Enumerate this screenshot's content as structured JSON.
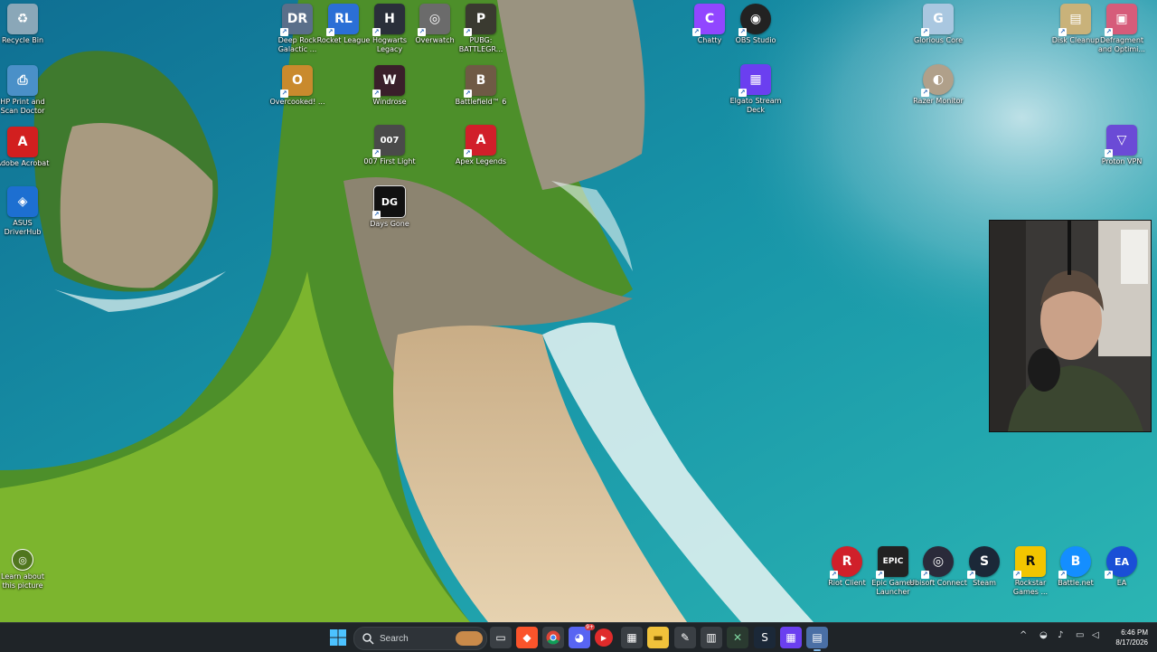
{
  "desktop_icons_left": [
    {
      "label": "Recycle Bin",
      "icon": "recycle-bin-icon",
      "color": "#8aa7b8",
      "glyph": "♻"
    },
    {
      "label": "HP Print and Scan Doctor",
      "icon": "printer-icon",
      "color": "#4a90c8",
      "glyph": "⎙"
    },
    {
      "label": "Adobe Acrobat",
      "icon": "acrobat-icon",
      "color": "#d21f1f",
      "glyph": "A"
    },
    {
      "label": "ASUS DriverHub",
      "icon": "asus-icon",
      "color": "#1d6fd1",
      "glyph": "◈"
    }
  ],
  "desktop_icons_games": [
    {
      "label": "Deep Rock Galactic ...",
      "icon": "deep-rock-icon",
      "color": "#5a6f8a",
      "glyph": "DR"
    },
    {
      "label": "Rocket League",
      "icon": "rocket-league-icon",
      "color": "#2b6fd6",
      "glyph": "RL"
    },
    {
      "label": "Hogwarts Legacy",
      "icon": "hogwarts-icon",
      "color": "#2a2f3a",
      "glyph": "H"
    },
    {
      "label": "Overwatch",
      "icon": "overwatch-icon",
      "color": "#6b6b6b",
      "glyph": "◎"
    },
    {
      "label": "PUBG: BATTLEGR...",
      "icon": "pubg-icon",
      "color": "#3a3a30",
      "glyph": "P"
    },
    {
      "label": "Overcooked! ...",
      "icon": "overcooked-icon",
      "color": "#c98a2d",
      "glyph": "O"
    },
    {
      "label": "Windrose",
      "icon": "windrose-icon",
      "color": "#3a1f2a",
      "glyph": "W"
    },
    {
      "label": "Battlefield™ 6",
      "icon": "battlefield-icon",
      "color": "#6f5a45",
      "glyph": "B"
    },
    {
      "label": "007 First Light",
      "icon": "007-icon",
      "color": "#4a4a4a",
      "glyph": "007"
    },
    {
      "label": "Apex Legends",
      "icon": "apex-icon",
      "color": "#d11f2a",
      "glyph": "A"
    },
    {
      "label": "Days Gone",
      "icon": "days-gone-icon",
      "color": "#111111",
      "glyph": "DG"
    }
  ],
  "desktop_icons_apps": [
    {
      "label": "Chatty",
      "icon": "chatty-icon",
      "color": "#9146ff",
      "glyph": "C"
    },
    {
      "label": "OBS Studio",
      "icon": "obs-icon",
      "color": "#222222",
      "glyph": "◉"
    },
    {
      "label": "Glorious Core",
      "icon": "glorious-icon",
      "color": "#a9c7e0",
      "glyph": "G"
    },
    {
      "label": "Elgato Stream Deck",
      "icon": "stream-deck-icon",
      "color": "#6b3ff0",
      "glyph": "▦"
    },
    {
      "label": "Razer Monitor",
      "icon": "monitor-icon",
      "color": "#b0a08a",
      "glyph": "◐"
    },
    {
      "label": "Disk Cleanup",
      "icon": "disk-cleanup-icon",
      "color": "#c9b27a",
      "glyph": "▤"
    },
    {
      "label": "Defragment and Optimi...",
      "icon": "defrag-icon",
      "color": "#d65c7a",
      "glyph": "▣"
    },
    {
      "label": "Proton VPN",
      "icon": "proton-vpn-icon",
      "color": "#6b4bd6",
      "glyph": "▽"
    }
  ],
  "launcher_icons": [
    {
      "label": "Riot Client",
      "icon": "riot-icon",
      "color": "#d0202a",
      "glyph": "R"
    },
    {
      "label": "Epic Games Launcher",
      "icon": "epic-icon",
      "color": "#222222",
      "glyph": "EPIC"
    },
    {
      "label": "Ubisoft Connect",
      "icon": "ubisoft-icon",
      "color": "#2a2a3a",
      "glyph": "◎"
    },
    {
      "label": "Steam",
      "icon": "steam-icon",
      "color": "#1b2838",
      "glyph": "S"
    },
    {
      "label": "Rockstar Games ...",
      "icon": "rockstar-icon",
      "color": "#f2c500",
      "glyph": "R"
    },
    {
      "label": "Battle.net",
      "icon": "battlenet-icon",
      "color": "#148eff",
      "glyph": "B"
    },
    {
      "label": "EA",
      "icon": "ea-icon",
      "color": "#1a4fd6",
      "glyph": "EA"
    }
  ],
  "learn_picture": {
    "label": "Learn about this picture",
    "icon": "camera-icon"
  },
  "taskbar": {
    "search_placeholder": "Search",
    "apps": [
      {
        "name": "task-view-icon",
        "color": "#3a3f44",
        "glyph": "▭"
      },
      {
        "name": "brave-icon",
        "color": "#fb542b",
        "glyph": "◆"
      },
      {
        "name": "chrome-icon",
        "color": "#3a3f44",
        "glyph": "◍"
      },
      {
        "name": "discord-icon",
        "color": "#5865f2",
        "glyph": "◕"
      },
      {
        "name": "youtube-icon",
        "color": "#e02b2b",
        "glyph": "▶"
      },
      {
        "name": "store-icon",
        "color": "#3a3f44",
        "glyph": "▦"
      },
      {
        "name": "file-explorer-icon",
        "color": "#f0c23b",
        "glyph": "▬"
      },
      {
        "name": "notes-icon",
        "color": "#3a3f44",
        "glyph": "✎"
      },
      {
        "name": "calculator-icon",
        "color": "#3a3f44",
        "glyph": "▥"
      },
      {
        "name": "excel-icon",
        "color": "#2a3a30",
        "glyph": "✕"
      },
      {
        "name": "steam-taskbar-icon",
        "color": "#1b2838",
        "glyph": "S"
      },
      {
        "name": "stream-deck-taskbar-icon",
        "color": "#6b3ff0",
        "glyph": "▦"
      },
      {
        "name": "monitor-taskbar-icon",
        "color": "#4a6fa5",
        "glyph": "▤"
      }
    ],
    "discord_badge": "9+",
    "clock_time": "6:46 PM",
    "clock_date": "8/17/2026"
  }
}
